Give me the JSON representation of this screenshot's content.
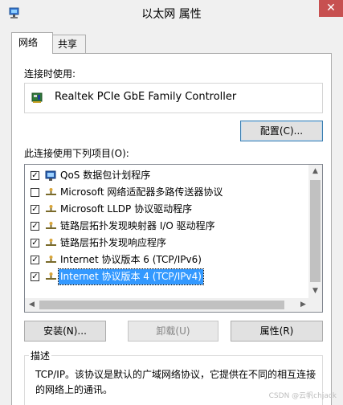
{
  "window": {
    "title": "以太网 属性",
    "close_glyph": "✕"
  },
  "tabs": [
    {
      "label": "网络",
      "active": true
    },
    {
      "label": "共享",
      "active": false
    }
  ],
  "connect_using": {
    "label": "连接时使用:",
    "adapter": "Realtek PCIe GbE Family Controller",
    "configure_button": "配置(C)..."
  },
  "items_label": "此连接使用下列项目(O):",
  "items": [
    {
      "checked": true,
      "icon": "qos-icon",
      "label": "QoS 数据包计划程序",
      "selected": false
    },
    {
      "checked": false,
      "icon": "protocol-icon",
      "label": "Microsoft 网络适配器多路传送器协议",
      "selected": false
    },
    {
      "checked": true,
      "icon": "protocol-icon",
      "label": "Microsoft LLDP 协议驱动程序",
      "selected": false
    },
    {
      "checked": true,
      "icon": "protocol-icon",
      "label": "链路层拓扑发现映射器 I/O 驱动程序",
      "selected": false
    },
    {
      "checked": true,
      "icon": "protocol-icon",
      "label": "链路层拓扑发现响应程序",
      "selected": false
    },
    {
      "checked": true,
      "icon": "protocol-icon",
      "label": "Internet 协议版本 6 (TCP/IPv6)",
      "selected": false
    },
    {
      "checked": true,
      "icon": "protocol-icon",
      "label": "Internet 协议版本 4 (TCP/IPv4)",
      "selected": true
    }
  ],
  "buttons": {
    "install": "安装(N)...",
    "uninstall": "卸载(U)",
    "properties": "属性(R)"
  },
  "description": {
    "legend": "描述",
    "text": "TCP/IP。该协议是默认的广域网络协议，它提供在不同的相互连接的网络上的通讯。"
  },
  "watermark": "CSDN @云帆chjack",
  "colors": {
    "selection": "#3399ff",
    "close_button": "#c75050"
  }
}
